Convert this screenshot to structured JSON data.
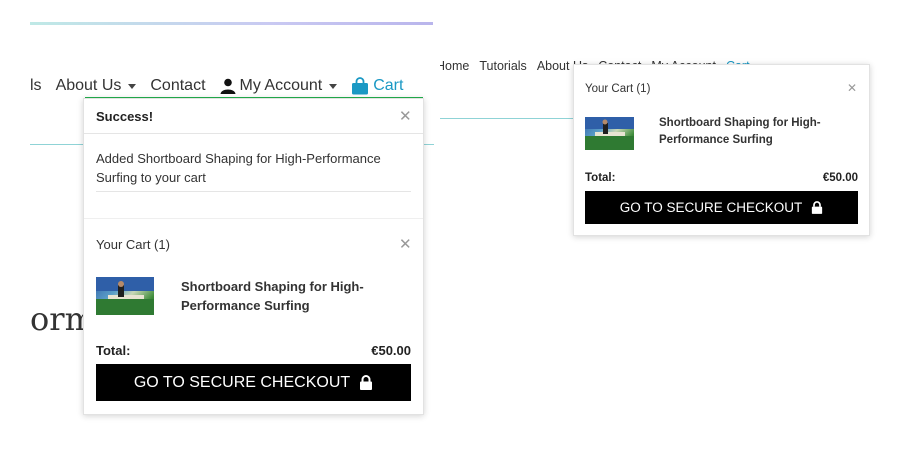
{
  "nav": {
    "items": [
      {
        "label": "ls"
      },
      {
        "label": "About Us"
      },
      {
        "label": "Contact"
      },
      {
        "label": "My Account"
      },
      {
        "label": "Cart"
      }
    ]
  },
  "hero": {
    "partial_title": "orma"
  },
  "notice": {
    "title": "Success!",
    "message": "Added Shortboard Shaping for High-Performance Surfing to your cart"
  },
  "mini_cart": {
    "title": "Your Cart (1)",
    "product_line1": "Shortboard Shaping for High-",
    "product_line2": "Performance Surfing",
    "total_label": "Total:",
    "total_value": "€50.00",
    "checkout_label": "GO TO SECURE CHECKOUT"
  },
  "right_nav": {
    "items": [
      {
        "label": "Home"
      },
      {
        "label": "Tutorials"
      },
      {
        "label": "About Us"
      },
      {
        "label": "Contact"
      },
      {
        "label": "My Account"
      },
      {
        "label": "Cart"
      }
    ]
  },
  "right_cart": {
    "title": "Your Cart (1)",
    "product_line1": "Shortboard Shaping for High-",
    "product_line2": "Performance Surfing",
    "total_label": "Total:",
    "total_value": "€50.00",
    "checkout_label": "GO TO SECURE CHECKOUT"
  },
  "colors": {
    "accent": "#1a98c4",
    "nav_active": "#22b14c",
    "checkout_bg": "#000000"
  },
  "icons": [
    "user-icon",
    "cart-bag-icon",
    "close-icon",
    "lock-icon",
    "caret-down-icon"
  ]
}
